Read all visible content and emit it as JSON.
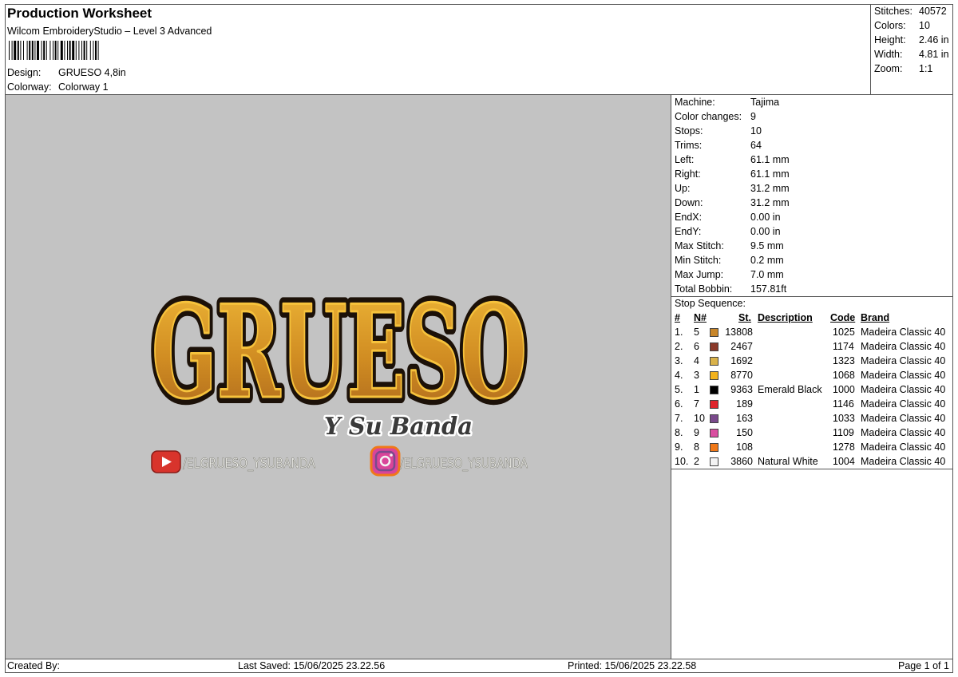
{
  "header": {
    "title": "Production Worksheet",
    "app": "Wilcom EmbroideryStudio – Level 3 Advanced",
    "design_label": "Design:",
    "design_value": "GRUESO 4,8in",
    "colorway_label": "Colorway:",
    "colorway_value": "Colorway 1"
  },
  "stats": [
    {
      "label": "Stitches:",
      "value": "40572"
    },
    {
      "label": "Colors:",
      "value": "10"
    },
    {
      "label": "Height:",
      "value": "2.46 in"
    },
    {
      "label": "Width:",
      "value": "4.81 in"
    },
    {
      "label": "Zoom:",
      "value": "1:1"
    }
  ],
  "machine_info": [
    {
      "label": "Machine:",
      "value": "Tajima"
    },
    {
      "label": "Color changes:",
      "value": "9"
    },
    {
      "label": "Stops:",
      "value": "10"
    },
    {
      "label": "Trims:",
      "value": "64"
    },
    {
      "label": "Left:",
      "value": "61.1 mm"
    },
    {
      "label": "Right:",
      "value": "61.1 mm"
    },
    {
      "label": "Up:",
      "value": "31.2 mm"
    },
    {
      "label": "Down:",
      "value": "31.2 mm"
    },
    {
      "label": "EndX:",
      "value": "0.00 in"
    },
    {
      "label": "EndY:",
      "value": "0.00 in"
    },
    {
      "label": "Max Stitch:",
      "value": "9.5 mm"
    },
    {
      "label": "Min Stitch:",
      "value": "0.2 mm"
    },
    {
      "label": "Max Jump:",
      "value": "7.0 mm"
    },
    {
      "label": "Total Bobbin:",
      "value": "157.81ft"
    }
  ],
  "stop_sequence": {
    "title": "Stop Sequence:",
    "headers": {
      "idx": "#",
      "n": "N#",
      "st": "St.",
      "desc": "Description",
      "code": "Code",
      "brand": "Brand"
    },
    "rows": [
      {
        "idx": "1.",
        "n": "5",
        "color": "#c8862a",
        "st": "13808",
        "desc": "",
        "code": "1025",
        "brand": "Madeira Classic 40"
      },
      {
        "idx": "2.",
        "n": "6",
        "color": "#8b3a2a",
        "st": "2467",
        "desc": "",
        "code": "1174",
        "brand": "Madeira Classic 40"
      },
      {
        "idx": "3.",
        "n": "4",
        "color": "#d9b24a",
        "st": "1692",
        "desc": "",
        "code": "1323",
        "brand": "Madeira Classic 40"
      },
      {
        "idx": "4.",
        "n": "3",
        "color": "#f2b21c",
        "st": "8770",
        "desc": "",
        "code": "1068",
        "brand": "Madeira Classic 40"
      },
      {
        "idx": "5.",
        "n": "1",
        "color": "#000000",
        "st": "9363",
        "desc": "Emerald Black",
        "code": "1000",
        "brand": "Madeira Classic 40"
      },
      {
        "idx": "6.",
        "n": "7",
        "color": "#e0242c",
        "st": "189",
        "desc": "",
        "code": "1146",
        "brand": "Madeira Classic 40"
      },
      {
        "idx": "7.",
        "n": "10",
        "color": "#7a4a8c",
        "st": "163",
        "desc": "",
        "code": "1033",
        "brand": "Madeira Classic 40"
      },
      {
        "idx": "8.",
        "n": "9",
        "color": "#d94ea0",
        "st": "150",
        "desc": "",
        "code": "1109",
        "brand": "Madeira Classic 40"
      },
      {
        "idx": "9.",
        "n": "8",
        "color": "#f07818",
        "st": "108",
        "desc": "",
        "code": "1278",
        "brand": "Madeira Classic 40"
      },
      {
        "idx": "10.",
        "n": "2",
        "color": "#f4f4f4",
        "st": "3860",
        "desc": "Natural White",
        "code": "1004",
        "brand": "Madeira Classic 40"
      }
    ]
  },
  "design_preview": {
    "main_text": "GRUESO",
    "sub_text": "Y Su Banda",
    "youtube_handle": "/ELGRUESO_YSUBANDA",
    "instagram_handle": "/ELGRUESO_YSUBANDA",
    "background": "#c3c3c3"
  },
  "footer": {
    "created_by": "Created By:",
    "last_saved": "Last Saved: 15/06/2025 23.22.56",
    "printed": "Printed: 15/06/2025 23.22.58",
    "page": "Page 1 of 1"
  }
}
